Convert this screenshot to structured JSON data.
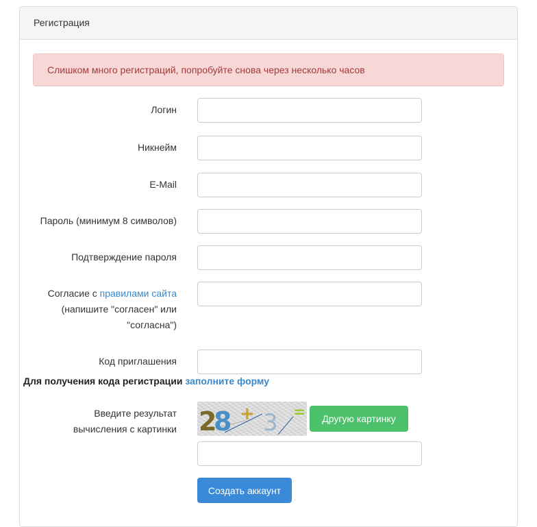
{
  "panel": {
    "title": "Регистрация"
  },
  "alert": {
    "text": "Слишком много регистраций, попробуйте снова через несколько часов"
  },
  "form": {
    "login_label": "Логин",
    "nickname_label": "Никнейм",
    "email_label": "E-Mail",
    "password_label": "Пароль (минимум 8 символов)",
    "password_confirm_label": "Подтверждение пароля",
    "agree_label_prefix": "Согласие с ",
    "agree_label_link": "правилами сайта",
    "agree_label_suffix": "(напишите \"согласен\" или \"согласна\")",
    "invite_label": "Код приглашения",
    "invite_note": "Для получения кода регистрации ",
    "invite_note_link": "заполните форму",
    "captcha_label": "Введите результат вычисления с картинки",
    "captcha_text": [
      "28",
      "+",
      "3",
      "="
    ],
    "refresh_captcha_button": "Другую картинку",
    "submit_button": "Создать аккаунт"
  },
  "colors": {
    "alert_bg": "#f8d7d7",
    "alert_text": "#a33a3a",
    "link": "#3a87c9",
    "green_button": "#4cc06a",
    "blue_button": "#3a8ad7"
  }
}
